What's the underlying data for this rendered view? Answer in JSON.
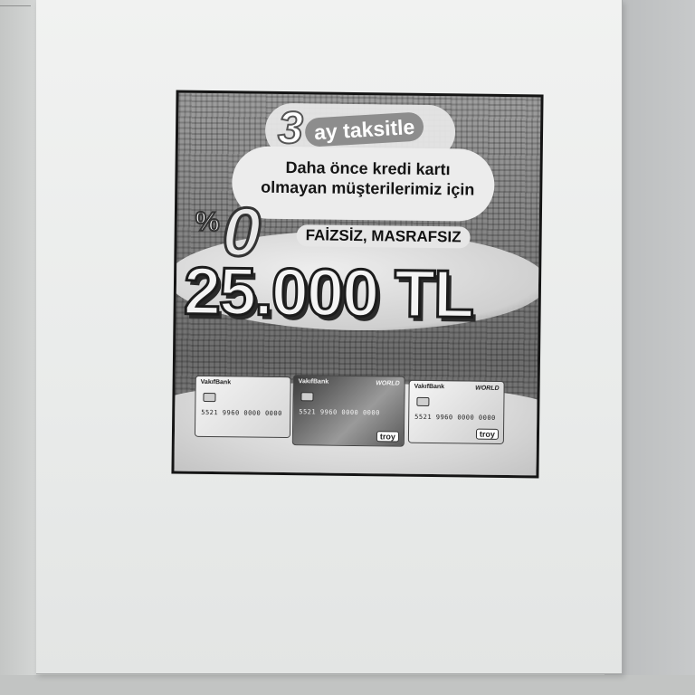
{
  "ad": {
    "installment_number": "3",
    "installment_text": "ay taksitle",
    "headline_line1": "Daha önce kredi kartı",
    "headline_line2": "olmayan müşterilerimiz için",
    "percent_sign": "%",
    "zero": "0",
    "fee_text": "FAİZSİZ, MASRAFSIZ",
    "amount": "25.000 TL"
  },
  "cards": [
    {
      "bank": "VakıfBank",
      "network": "",
      "number": "5521 9960 0000 0000",
      "brand": ""
    },
    {
      "bank": "VakıfBank",
      "network": "WORLD",
      "number": "5521 9960 0000 0000",
      "brand": "troy"
    },
    {
      "bank": "VakıfBank",
      "network": "WORLD",
      "number": "5521 9960 0000 0000",
      "brand": "troy"
    }
  ]
}
